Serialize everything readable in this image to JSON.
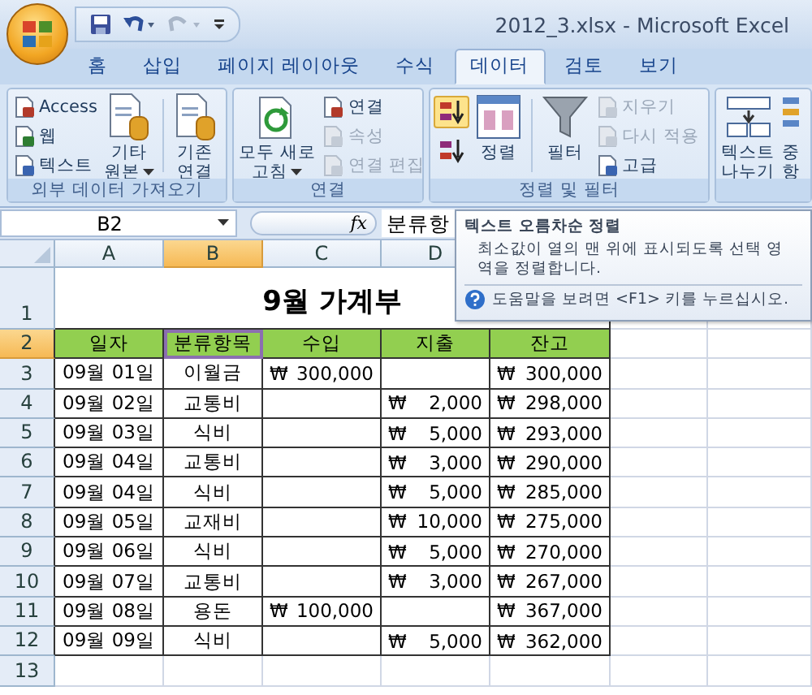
{
  "window": {
    "title": "2012_3.xlsx - Microsoft Excel"
  },
  "tabs": [
    {
      "label": "홈",
      "selected": false
    },
    {
      "label": "삽입",
      "selected": false
    },
    {
      "label": "페이지 레이아웃",
      "selected": false
    },
    {
      "label": "수식",
      "selected": false
    },
    {
      "label": "데이터",
      "selected": true
    },
    {
      "label": "검토",
      "selected": false
    },
    {
      "label": "보기",
      "selected": false
    }
  ],
  "ribbon": [
    {
      "title": "외부 데이터 가져오기",
      "columns": [
        {
          "kind": "small",
          "items": [
            {
              "label": "Access",
              "disabled": false
            },
            {
              "label": "웹",
              "disabled": false
            },
            {
              "label": "텍스트",
              "disabled": false
            }
          ]
        },
        {
          "kind": "large",
          "items": [
            {
              "lines": [
                "기타",
                "원본"
              ],
              "dropdown": true
            }
          ]
        },
        {
          "kind": "separator"
        },
        {
          "kind": "large",
          "items": [
            {
              "lines": [
                "기존",
                "연결"
              ],
              "dropdown": false
            }
          ]
        }
      ]
    },
    {
      "title": "연결",
      "columns": [
        {
          "kind": "large",
          "items": [
            {
              "lines": [
                "모두 새로",
                "고침"
              ],
              "dropdown": true
            }
          ]
        },
        {
          "kind": "small",
          "items": [
            {
              "label": "연결",
              "disabled": false
            },
            {
              "label": "속성",
              "disabled": true
            },
            {
              "label": "연결 편집",
              "disabled": true
            }
          ]
        }
      ]
    },
    {
      "title": "정렬 및 필터",
      "columns": [
        {
          "kind": "icons",
          "items": [
            {
              "highlighted": true
            },
            {
              "highlighted": false
            }
          ]
        },
        {
          "kind": "large",
          "items": [
            {
              "lines": [
                "정렬"
              ],
              "dropdown": false
            }
          ]
        },
        {
          "kind": "separator"
        },
        {
          "kind": "large",
          "items": [
            {
              "lines": [
                "필터"
              ],
              "dropdown": false
            }
          ]
        },
        {
          "kind": "small",
          "items": [
            {
              "label": "지우기",
              "disabled": true
            },
            {
              "label": "다시 적용",
              "disabled": true
            },
            {
              "label": "고급",
              "disabled": false
            }
          ]
        }
      ]
    },
    {
      "columns": [
        {
          "kind": "large",
          "items": [
            {
              "lines": [
                "텍스트",
                "나누기"
              ],
              "dropdown": false
            }
          ]
        },
        {
          "kind": "large",
          "items": [
            {
              "lines": [
                "중",
                "항"
              ],
              "dropdown": false
            }
          ]
        }
      ]
    }
  ],
  "formula_bar": {
    "name_box": "B2",
    "fx": "fx",
    "content": "분류항"
  },
  "tooltip": {
    "title": "텍스트 오름차순 정렬",
    "body": "최소값이 열의 맨 위에 표시되도록 선택 영역을 정렬합니다.",
    "help": "도움말을 보려면 <F1> 키를 누르십시오."
  },
  "sheet": {
    "columns": [
      {
        "label": "A",
        "selected": false
      },
      {
        "label": "B",
        "selected": true
      },
      {
        "label": "C",
        "selected": false
      },
      {
        "label": "D",
        "selected": false
      }
    ],
    "title_row": {
      "number": "1",
      "selected": false,
      "text": "9월 가계부"
    },
    "header_row": {
      "number": "2",
      "selected": true,
      "cells": [
        {
          "text": "일자",
          "active": false
        },
        {
          "text": "분류항목",
          "active": true
        },
        {
          "text": "수입",
          "active": false
        },
        {
          "text": "지출",
          "active": false
        },
        {
          "text": "잔고",
          "active": false
        }
      ]
    },
    "rows": [
      {
        "number": "3",
        "selected": false,
        "date": "09월 01일",
        "category": "이월금",
        "income": {
          "currency": "₩",
          "amount": "300,000"
        },
        "balance": {
          "currency": "₩",
          "amount": "300,000"
        }
      },
      {
        "number": "4",
        "selected": false,
        "date": "09월 02일",
        "category": "교통비",
        "expense": {
          "currency": "₩",
          "amount": "2,000"
        },
        "balance": {
          "currency": "₩",
          "amount": "298,000"
        }
      },
      {
        "number": "5",
        "selected": false,
        "date": "09월 03일",
        "category": "식비",
        "expense": {
          "currency": "₩",
          "amount": "5,000"
        },
        "balance": {
          "currency": "₩",
          "amount": "293,000"
        }
      },
      {
        "number": "6",
        "selected": false,
        "date": "09월 04일",
        "category": "교통비",
        "expense": {
          "currency": "₩",
          "amount": "3,000"
        },
        "balance": {
          "currency": "₩",
          "amount": "290,000"
        }
      },
      {
        "number": "7",
        "selected": false,
        "date": "09월 04일",
        "category": "식비",
        "expense": {
          "currency": "₩",
          "amount": "5,000"
        },
        "balance": {
          "currency": "₩",
          "amount": "285,000"
        }
      },
      {
        "number": "8",
        "selected": false,
        "date": "09월 05일",
        "category": "교재비",
        "expense": {
          "currency": "₩",
          "amount": "10,000"
        },
        "balance": {
          "currency": "₩",
          "amount": "275,000"
        }
      },
      {
        "number": "9",
        "selected": false,
        "date": "09월 06일",
        "category": "식비",
        "expense": {
          "currency": "₩",
          "amount": "5,000"
        },
        "balance": {
          "currency": "₩",
          "amount": "270,000"
        }
      },
      {
        "number": "10",
        "selected": false,
        "date": "09월 07일",
        "category": "교통비",
        "expense": {
          "currency": "₩",
          "amount": "3,000"
        },
        "balance": {
          "currency": "₩",
          "amount": "267,000"
        }
      },
      {
        "number": "11",
        "selected": false,
        "date": "09월 08일",
        "category": "용돈",
        "income": {
          "currency": "₩",
          "amount": "100,000"
        },
        "balance": {
          "currency": "₩",
          "amount": "367,000"
        }
      },
      {
        "number": "12",
        "selected": false,
        "date": "09월 09일",
        "category": "식비",
        "expense": {
          "currency": "₩",
          "amount": "5,000"
        },
        "balance": {
          "currency": "₩",
          "amount": "362,000"
        }
      }
    ],
    "empty_rows": [
      "13"
    ]
  }
}
